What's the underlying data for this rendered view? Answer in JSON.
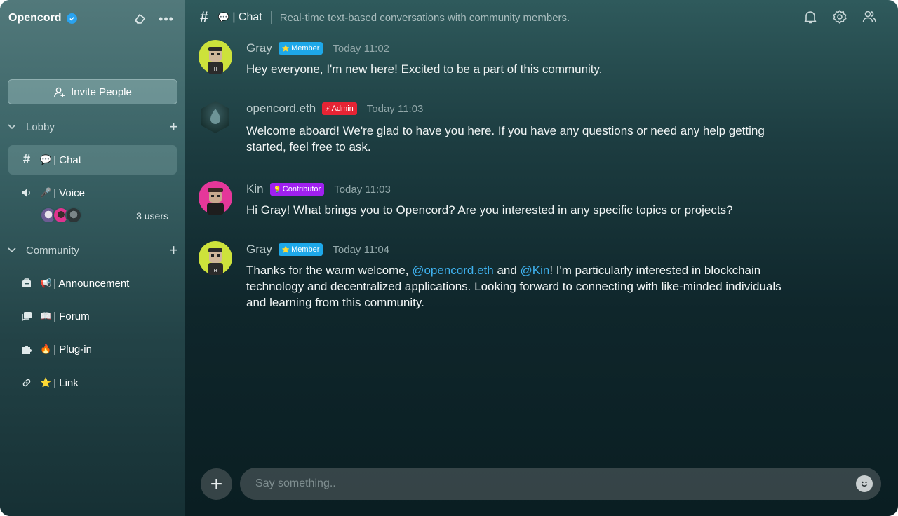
{
  "server": {
    "name": "Opencord"
  },
  "sidebar": {
    "invite_label": "Invite People",
    "categories": [
      {
        "label": "Lobby"
      },
      {
        "label": "Community"
      }
    ],
    "channels": [
      {
        "emoji": "💬",
        "label": "| Chat",
        "icon": "hash-icon"
      },
      {
        "emoji": "🎤",
        "label": "| Voice",
        "icon": "speaker-icon"
      },
      {
        "emoji": "📢",
        "label": "| Announcement",
        "icon": "calendar-icon"
      },
      {
        "emoji": "📖",
        "label": "| Forum",
        "icon": "forum-icon"
      },
      {
        "emoji": "🔥",
        "label": "| Plug-in",
        "icon": "puzzle-icon"
      },
      {
        "emoji": "⭐",
        "label": "| Link",
        "icon": "link-icon"
      }
    ],
    "voice_users_count": "3 users"
  },
  "topbar": {
    "channel_emoji": "💬",
    "channel_title": "| Chat",
    "description": "Real-time text-based conversations with community members."
  },
  "messages": [
    {
      "author": "Gray",
      "badge": "Member",
      "badge_icon": "⭐",
      "time": "Today 11:02",
      "text": "Hey everyone, I'm new here! Excited to be a part of this community."
    },
    {
      "author": "opencord.eth",
      "badge": "Admin",
      "badge_icon": "⚡",
      "time": "Today 11:03",
      "text_line1": "Welcome aboard! We're glad to have you here. If you have any questions or need any help getting",
      "text_line2": "started, feel free to ask."
    },
    {
      "author": "Kin",
      "badge": "Contributor",
      "badge_icon": "💡",
      "time": "Today 11:03",
      "text": "Hi Gray! What brings you to Opencord? Are you interested in any specific topics or projects?"
    },
    {
      "author": "Gray",
      "badge": "Member",
      "badge_icon": "⭐",
      "time": "Today 11:04",
      "text_prefix": "Thanks for the warm welcome, ",
      "mention1": "@opencord.eth",
      "text_mid": " and ",
      "mention2": "@Kin",
      "text_suffix1": "! I'm particularly interested in blockchain",
      "text_line2": "technology and decentralized applications. Looking forward to connecting with like-minded individuals",
      "text_line3": "and learning from this community."
    }
  ],
  "composer": {
    "placeholder": "Say something.."
  },
  "colors": {
    "accent_blue": "#1ea8e9",
    "admin_red": "#e62434",
    "contributor_purple": "#a020f0",
    "mention": "#3fb2f0"
  }
}
